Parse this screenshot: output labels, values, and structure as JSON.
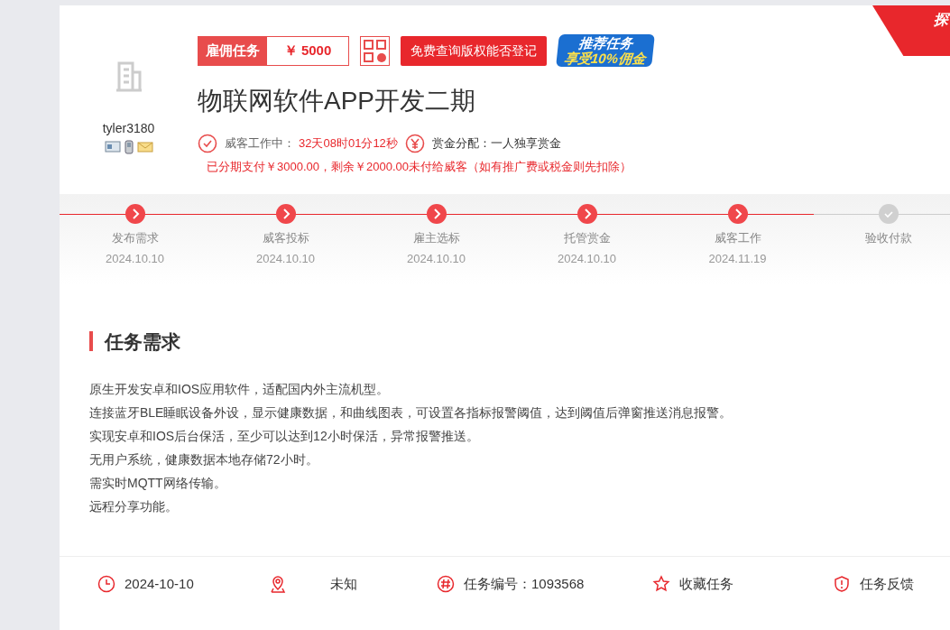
{
  "corner_ribbon": {
    "text": "探"
  },
  "employer": {
    "name": "tyler3180"
  },
  "task_type": {
    "label": "雇佣任务",
    "reward": "￥ 5000"
  },
  "copyright_button": "免费查询版权能否登记",
  "promo_banner": {
    "line_1": "推荐任务",
    "line_2": "享受10%佣金"
  },
  "title": "物联网软件APP开发二期",
  "status": {
    "label": "威客工作中：",
    "countdown": "32天08时01分12秒",
    "distribution_label": "赏金分配：一人独享赏金"
  },
  "payment_note": "已分期支付￥3000.00，剩余￥2000.00未付给威客（如有推广费或税金则先扣除）",
  "steps": [
    {
      "label": "发布需求",
      "date": "2024.10.10",
      "done": true
    },
    {
      "label": "威客投标",
      "date": "2024.10.10",
      "done": true
    },
    {
      "label": "雇主选标",
      "date": "2024.10.10",
      "done": true
    },
    {
      "label": "托管赏金",
      "date": "2024.10.10",
      "done": true
    },
    {
      "label": "威客工作",
      "date": "2024.11.19",
      "done": true
    },
    {
      "label": "验收付款",
      "done": false
    }
  ],
  "requirements": {
    "heading": "任务需求",
    "lines": [
      "原生开发安卓和IOS应用软件，适配国内外主流机型。",
      "连接蓝牙BLE睡眠设备外设，显示健康数据，和曲线图表，可设置各指标报警阈值，达到阈值后弹窗推送消息报警。",
      "实现安卓和IOS后台保活，至少可以达到12小时保活，异常报警推送。",
      "无用户系统，健康数据本地存储72小时。",
      "需实时MQTT网络传输。",
      "远程分享功能。"
    ]
  },
  "footer": [
    {
      "kind": "date",
      "text": "2024-10-10"
    },
    {
      "kind": "location",
      "text": "未知"
    },
    {
      "kind": "number",
      "text": "任务编号：1093568"
    },
    {
      "kind": "favorite",
      "text": "收藏任务"
    },
    {
      "kind": "report",
      "text": "任务反馈"
    }
  ]
}
